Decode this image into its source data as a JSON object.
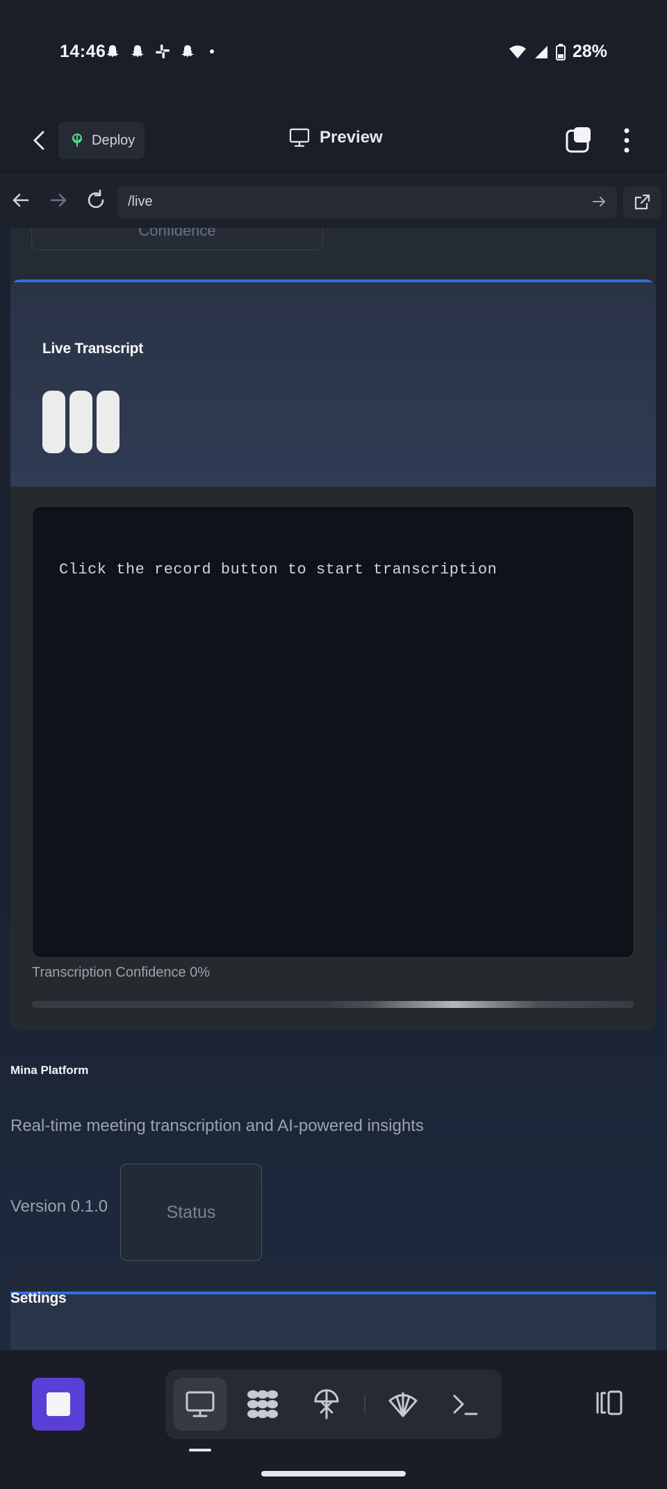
{
  "status_bar": {
    "time": "14:46",
    "notification_icons": [
      "snapchat-icon",
      "snapchat-icon",
      "slack-icon",
      "snapchat-icon"
    ],
    "battery": "28%"
  },
  "header": {
    "deploy_label": "Deploy",
    "title": "Preview"
  },
  "browser": {
    "url": "/live"
  },
  "previous_card": {
    "label": "Confidence"
  },
  "live_card": {
    "title": "Live Transcript",
    "placeholder": "Click the record button to start transcription",
    "confidence_label": "Transcription Confidence 0%",
    "confidence_value": 0
  },
  "platform": {
    "title": "Mina Platform",
    "description": "Real-time meeting transcription and AI-powered insights",
    "version": "Version 0.1.0",
    "status_label": "Status"
  },
  "settings": {
    "title": "Settings"
  },
  "dock": {
    "tools": [
      "desktop-icon",
      "apps-grid-icon",
      "deploy-icon",
      "shell-icon",
      "terminal-icon"
    ],
    "active_tool": "desktop-icon"
  },
  "colors": {
    "accent_blue": "#2f6fe0",
    "stop_purple": "#5a3fd6",
    "deploy_green": "#4ade80"
  }
}
